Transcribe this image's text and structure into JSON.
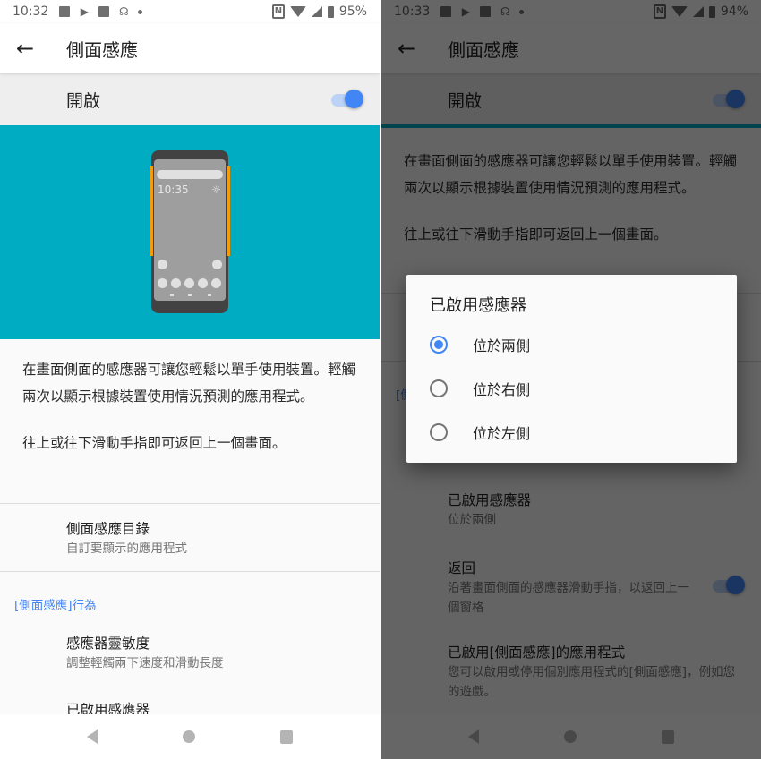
{
  "left": {
    "status": {
      "time": "10:32",
      "battery": "95%",
      "notification_icons": [
        "image-icon",
        "play-store-icon",
        "facebook-icon",
        "missed-call-icon",
        "dot-icon"
      ],
      "system_icons": [
        "nfc-icon",
        "wifi-icon",
        "signal-icon",
        "battery-icon"
      ]
    },
    "appbar": {
      "title": "側面感應"
    },
    "master_switch": {
      "label": "開啟",
      "on": true
    },
    "illustration": {
      "time": "10:35",
      "weather": "☼"
    },
    "description": [
      "在畫面側面的感應器可讓您輕鬆以單手使用裝置。輕觸兩次以顯示根據裝置使用情況預測的應用程式。",
      "往上或往下滑動手指即可返回上一個畫面。"
    ],
    "prefs": [
      {
        "title": "側面感應目錄",
        "summary": "自訂要顯示的應用程式"
      }
    ],
    "category": "[側面感應]行為",
    "category_prefs": [
      {
        "title": "感應器靈敏度",
        "summary": "調整輕觸兩下速度和滑動長度"
      },
      {
        "title": "已啟用感應器",
        "summary": ""
      }
    ]
  },
  "right": {
    "status": {
      "time": "10:33",
      "battery": "94%"
    },
    "appbar": {
      "title": "側面感應"
    },
    "master_switch": {
      "label": "開啟",
      "on": true
    },
    "description": [
      "在畫面側面的感應器可讓您輕鬆以單手使用裝置。輕觸兩次以顯示根據裝置使用情況預測的應用程式。",
      "往上或往下滑動手指即可返回上一個畫面。"
    ],
    "category_peek": "[側",
    "prefs": [
      {
        "title": "已啟用感應器",
        "summary": "位於兩側"
      },
      {
        "title": "返回",
        "summary": "沿著畫面側面的感應器滑動手指，以返回上一個窗格",
        "toggle_on": true
      },
      {
        "title": "已啟用[側面感應]的應用程式",
        "summary": "您可以啟用或停用個別應用程式的[側面感應]，例如您的遊戲。"
      }
    ],
    "dialog": {
      "title": "已啟用感應器",
      "options": [
        {
          "label": "位於兩側",
          "selected": true
        },
        {
          "label": "位於右側",
          "selected": false
        },
        {
          "label": "位於左側",
          "selected": false
        }
      ]
    }
  },
  "navbar": {
    "back": "back-icon",
    "home": "home-icon",
    "recents": "recents-icon"
  },
  "colors": {
    "accent": "#4285f4",
    "hero": "#00acc1",
    "edge_sensor": "#f39c12"
  }
}
